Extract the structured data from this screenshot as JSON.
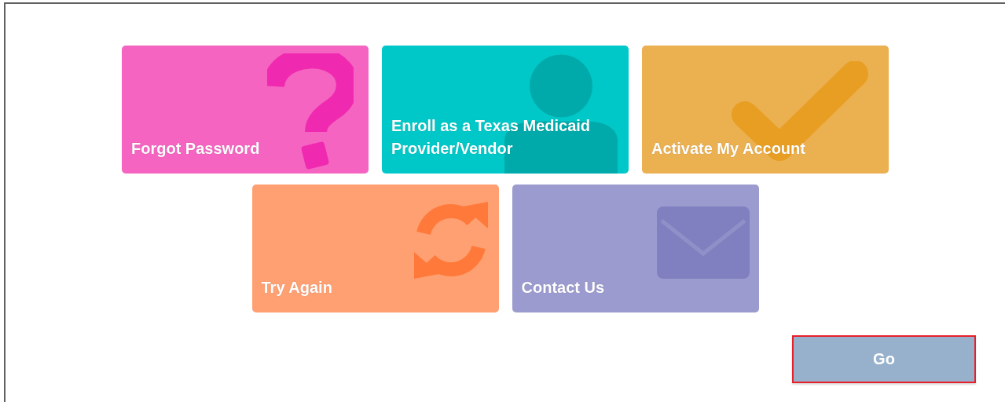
{
  "tiles": [
    {
      "label": "Forgot Password",
      "kind": "question",
      "color": "#f464c0"
    },
    {
      "label": "Enroll as a Texas Medicaid Provider/Vendor",
      "kind": "person",
      "color": "#00c8c8"
    },
    {
      "label": "Activate My Account",
      "kind": "check",
      "color": "#ebb050"
    },
    {
      "label": "Try Again",
      "kind": "refresh",
      "color": "#ffa073"
    },
    {
      "label": "Contact Us",
      "kind": "mail",
      "color": "#9b9bcf"
    }
  ],
  "go_button": {
    "label": "Go",
    "focused": true
  }
}
